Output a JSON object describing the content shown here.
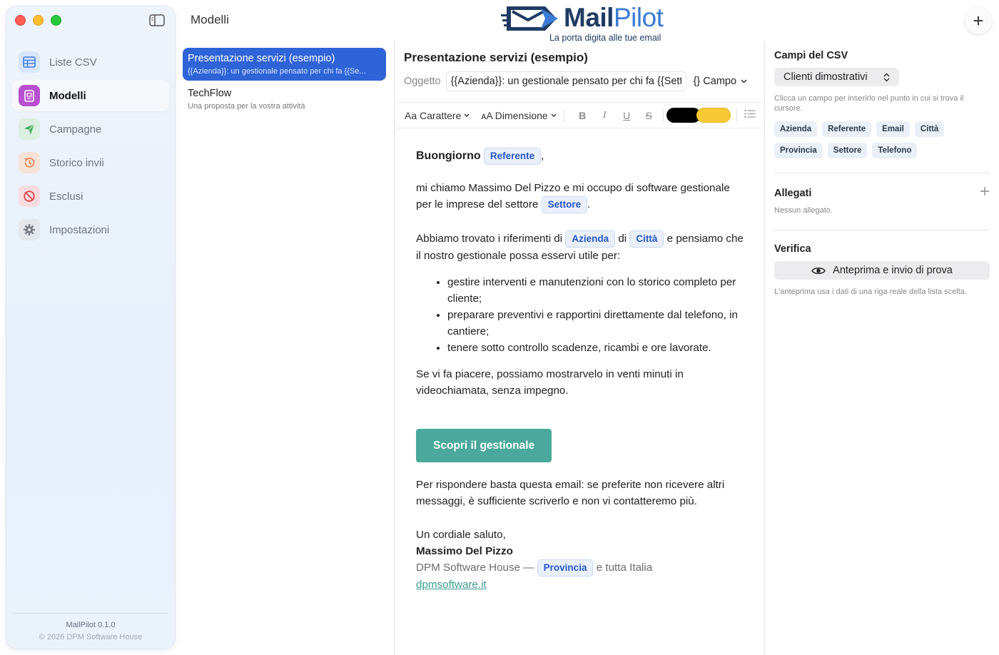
{
  "sidebar": {
    "items": [
      {
        "label": "Liste CSV",
        "icon": "table-icon"
      },
      {
        "label": "Modelli",
        "icon": "template-icon"
      },
      {
        "label": "Campagne",
        "icon": "send-icon"
      },
      {
        "label": "Storico invii",
        "icon": "history-icon"
      },
      {
        "label": "Esclusi",
        "icon": "block-icon"
      },
      {
        "label": "Impostazioni",
        "icon": "gear-icon"
      }
    ],
    "active": "Modelli",
    "version": "MailPilot 0.1.0",
    "copyright": "© 2026 DPM Software House"
  },
  "header": {
    "title": "Modelli",
    "logo_mail": "Mail",
    "logo_pilot": "Pilot",
    "tagline": "La porta digita alle tue email",
    "add_label": "+"
  },
  "templates": [
    {
      "name": "Presentazione servizi (esempio)",
      "preview": "{{Azienda}}: un gestionale pensato per chi fa {{Se...",
      "selected": true
    },
    {
      "name": "TechFlow",
      "preview": "Una proposta per la vostra attività",
      "selected": false
    }
  ],
  "editor": {
    "title": "Presentazione servizi (esempio)",
    "subject_label": "Oggetto",
    "subject_value": "{{Azienda}}: un gestionale pensato per chi fa {{Settore}}",
    "field_button": "{} Campo",
    "toolbar": {
      "font": "Aa Carattere",
      "size": "ᴀA Dimensione",
      "bold": "B",
      "italic": "I",
      "underline": "U",
      "strike": "S",
      "color_text": "#000000",
      "color_highlight": "#f7c934"
    },
    "body": {
      "greeting": "Buongiorno",
      "greeting_chip": "Referente",
      "greeting_end": ",",
      "p1_a": "mi chiamo Massimo Del Pizzo e mi occupo di software gestionale per le imprese del settore",
      "p1_chip": "Settore",
      "p1_end": ".",
      "p2_a": "Abbiamo trovato i riferimenti di",
      "p2_chip1": "Azienda",
      "p2_mid": "di",
      "p2_chip2": "Città",
      "p2_end": "e pensiamo che il nostro gestionale possa esservi utile per:",
      "bullets": [
        "gestire interventi e manutenzioni con lo storico completo per cliente;",
        "preparare preventivi e rapportini direttamente dal telefono, in cantiere;",
        "tenere sotto controllo scadenze, ricambi e ore lavorate."
      ],
      "p3": "Se vi fa piacere, possiamo mostrarvelo in venti minuti in videochiamata, senza impegno.",
      "cta": "Scopri il gestionale",
      "p4": "Per rispondere basta questa email: se preferite non ricevere altri messaggi, è sufficiente scriverlo e non vi contatteremo più.",
      "closing": "Un cordiale saluto,",
      "sender": "Massimo Del Pizzo",
      "company": "DPM Software House —",
      "company_chip": "Provincia",
      "company_end": "e tutta Italia",
      "link": "dpmsoftware.it",
      "cta_color": "#4aa99a"
    }
  },
  "right_panel": {
    "csv_title": "Campi del CSV",
    "csv_select": "Clienti dimostrativi",
    "csv_hint": "Clicca un campo per inserirlo nel punto in cui si trova il cursore.",
    "fields": [
      "Azienda",
      "Referente",
      "Email",
      "Città",
      "Provincia",
      "Settore",
      "Telefono"
    ],
    "attachments_title": "Allegati",
    "attachments_empty": "Nessun allegato.",
    "verify_title": "Verifica",
    "preview_button": "Anteprima e invio di prova",
    "preview_hint": "L'anteprima usa i dati di una riga reale della lista scelta."
  },
  "colors": {
    "accent": "#2f64d8",
    "brand_dark": "#1f3b63",
    "brand_light": "#3a7bd5",
    "chip_text": "#2256c9"
  }
}
